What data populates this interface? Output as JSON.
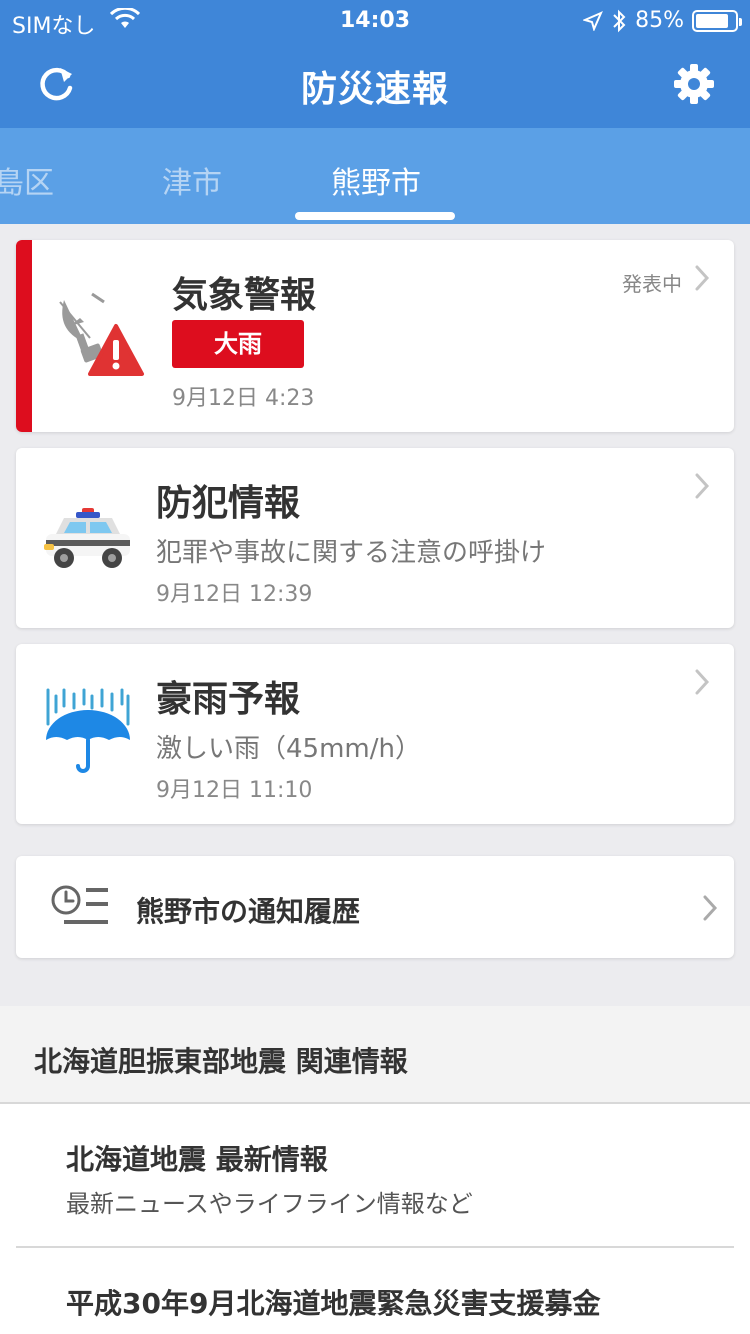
{
  "status_bar": {
    "carrier": "SIMなし",
    "time": "14:03",
    "battery": "85%",
    "battery_level": 0.85
  },
  "nav": {
    "title": "防災速報"
  },
  "tabs": [
    {
      "label": "島区"
    },
    {
      "label": "津市"
    },
    {
      "label": "熊野市",
      "active": true
    }
  ],
  "cards": {
    "weather": {
      "status": "発表中",
      "title": "気象警報",
      "badge": "大雨",
      "time": "9月12日 4:23"
    },
    "crime": {
      "title": "防犯情報",
      "subtitle": "犯罪や事故に関する注意の呼掛け",
      "time": "9月12日 12:39"
    },
    "rain": {
      "title": "豪雨予報",
      "subtitle": "激しい雨（45mm/h）",
      "time": "9月12日 11:10"
    }
  },
  "history": {
    "label": "熊野市の通知履歴"
  },
  "related": {
    "header": "北海道胆振東部地震 関連情報",
    "items": [
      {
        "title": "北海道地震 最新情報",
        "subtitle": "最新ニュースやライフライン情報など"
      },
      {
        "title": "平成30年9月北海道地震緊急災害支援募金"
      }
    ]
  },
  "colors": {
    "header_blue": "#3f86d8",
    "tab_blue": "#5ba0e6",
    "alert_red": "#dd0d1e"
  },
  "icons": {
    "refresh": "refresh-icon",
    "settings": "gear-icon",
    "weather": "satellite-warning-icon",
    "crime": "police-car-icon",
    "rain": "umbrella-rain-icon",
    "history": "clock-list-icon"
  }
}
